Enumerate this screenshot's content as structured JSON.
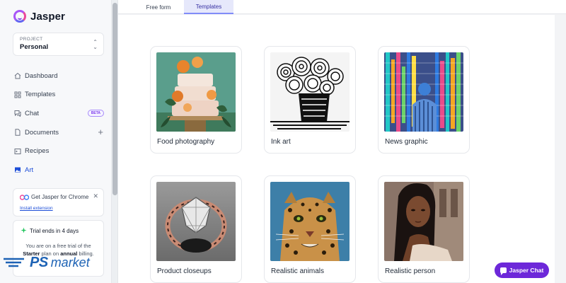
{
  "brand": {
    "name": "Jasper"
  },
  "project": {
    "caption": "PROJECT",
    "value": "Personal"
  },
  "nav": {
    "items": [
      {
        "label": "Dashboard",
        "icon": "home-icon"
      },
      {
        "label": "Templates",
        "icon": "grid-icon"
      },
      {
        "label": "Chat",
        "icon": "chat-bubble-icon",
        "badge": "BETA"
      },
      {
        "label": "Documents",
        "icon": "document-icon",
        "action": "+"
      },
      {
        "label": "Recipes",
        "icon": "terminal-icon"
      },
      {
        "label": "Art",
        "icon": "image-icon",
        "active": true
      }
    ]
  },
  "chrome_promo": {
    "title": "Get Jasper for Chrome",
    "link": "Install extension",
    "close": "✕"
  },
  "trial": {
    "title": "Trial ends in 4 days",
    "line_start": "You are on a free trial of the",
    "plan": "Starter",
    "line_mid": "plan on",
    "billing": "annual",
    "line_end": "billing."
  },
  "watermark": {
    "text_a": "PS",
    "text_b": "market"
  },
  "tabs": {
    "free_form": "Free form",
    "templates": "Templates",
    "active": "templates"
  },
  "cards": [
    {
      "label": "Food photography",
      "image": "layered-cake-with-orange-flowers"
    },
    {
      "label": "Ink art",
      "image": "black-ink-roses-in-vase"
    },
    {
      "label": "News graphic",
      "image": "colorful-pixel-mosaic-figure"
    },
    {
      "label": "Product closeups",
      "image": "diamond-ring-closeup"
    },
    {
      "label": "Realistic animals",
      "image": "leopard-portrait"
    },
    {
      "label": "Realistic person",
      "image": "woman-portrait"
    }
  ],
  "chat_button": {
    "label": "Jasper Chat"
  },
  "colors": {
    "accent": "#6d28d9",
    "active_nav": "#1d4ed8",
    "tab_active_bg": "#e6e8fb"
  }
}
